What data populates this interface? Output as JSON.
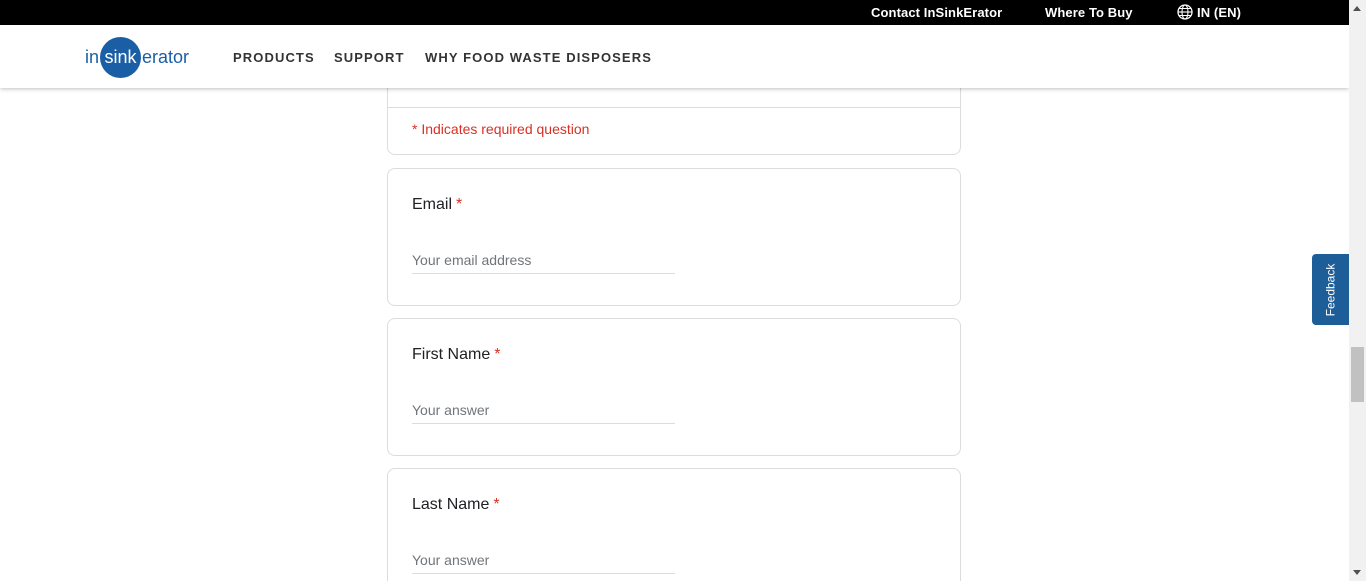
{
  "topbar": {
    "contact": "Contact InSinkErator",
    "where_to_buy": "Where To Buy",
    "language": "IN (EN)"
  },
  "header": {
    "logo": {
      "left": "in",
      "mid": "sink",
      "right": "erator"
    },
    "nav": [
      "PRODUCTS",
      "SUPPORT",
      "WHY FOOD WASTE DISPOSERS"
    ]
  },
  "form": {
    "required_note": "* Indicates required question",
    "questions": [
      {
        "title": "Email",
        "star": "*",
        "placeholder": "Your email address"
      },
      {
        "title": "First Name",
        "star": "*",
        "placeholder": "Your answer"
      },
      {
        "title": "Last Name",
        "star": "*",
        "placeholder": "Your answer"
      }
    ]
  },
  "feedback": {
    "label": "Feedback"
  },
  "colors": {
    "brand_blue": "#1a5fa6",
    "required_red": "#d93025"
  }
}
